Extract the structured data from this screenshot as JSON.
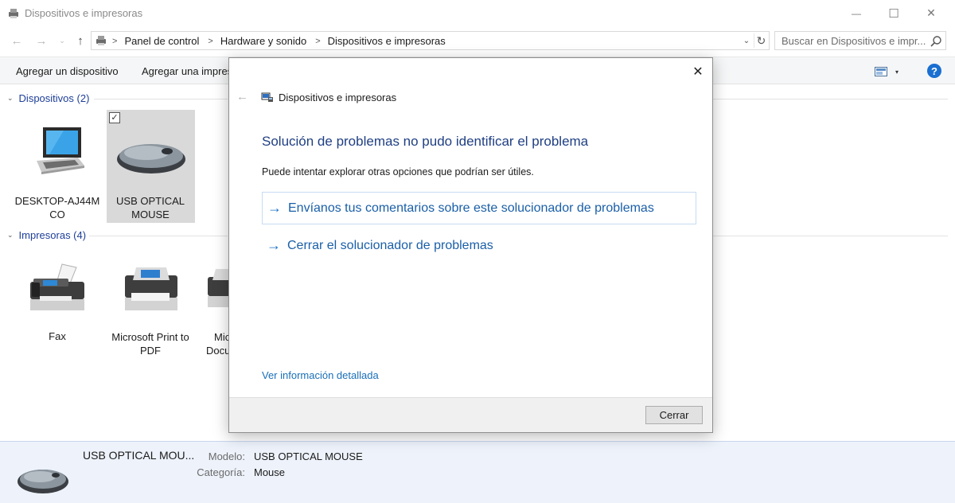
{
  "window": {
    "title": "Dispositivos e impresoras",
    "minimize_glyph": "—",
    "maximize_glyph": "☐",
    "close_glyph": "✕"
  },
  "nav": {
    "back_glyph": "←",
    "forward_glyph": "→",
    "recent_glyph": "⌄",
    "up_glyph": "↑",
    "breadcrumbs": [
      "Panel de control",
      "Hardware y sonido",
      "Dispositivos e impresoras"
    ],
    "breadcrumb_sep": ">",
    "dropdown_glyph": "⌄",
    "refresh_glyph": "↻",
    "search_placeholder": "Buscar en Dispositivos e impr..."
  },
  "toolbar": {
    "add_device": "Agregar un dispositivo",
    "add_printer": "Agregar una impres",
    "view_chevron": "▾",
    "help": "?"
  },
  "groups": {
    "devices": {
      "header": "Dispositivos (2)",
      "items": [
        {
          "name": "DESKTOP-AJ44M\nCO",
          "line1": "DESKTOP-AJ44M",
          "line2": "CO"
        },
        {
          "name": "USB OPTICAL MOUSE",
          "line1": "USB OPTICAL",
          "line2": "MOUSE",
          "selected": true
        }
      ]
    },
    "printers": {
      "header": "Impresoras (4)",
      "items": [
        {
          "line1": "Fax",
          "line2": ""
        },
        {
          "line1": "Microsoft Print to",
          "line2": "PDF"
        },
        {
          "line1": "Mic",
          "line2": "Docu"
        }
      ]
    },
    "chevron": "⌄",
    "check": "✓"
  },
  "details": {
    "name": "USB OPTICAL MOU...",
    "model_label": "Modelo:",
    "model_value": "USB OPTICAL MOUSE",
    "category_label": "Categoría:",
    "category_value": "Mouse"
  },
  "dialog": {
    "close_glyph": "✕",
    "back_glyph": "←",
    "header_title": "Dispositivos e impresoras",
    "main_title": "Solución de problemas no pudo identificar el problema",
    "description": "Puede intentar explorar otras opciones que podrían ser útiles.",
    "option_arrow": "→",
    "options": [
      "Envíanos tus comentarios sobre este solucionador de problemas",
      "Cerrar el solucionador de problemas"
    ],
    "details_link": "Ver información detallada",
    "close_button": "Cerrar"
  },
  "colors": {
    "accent": "#1a70c9",
    "title_blue": "#1f3f83",
    "group_blue": "#1e3f99",
    "details_bg": "#edf2fb",
    "selection": "#d9d9d9"
  }
}
